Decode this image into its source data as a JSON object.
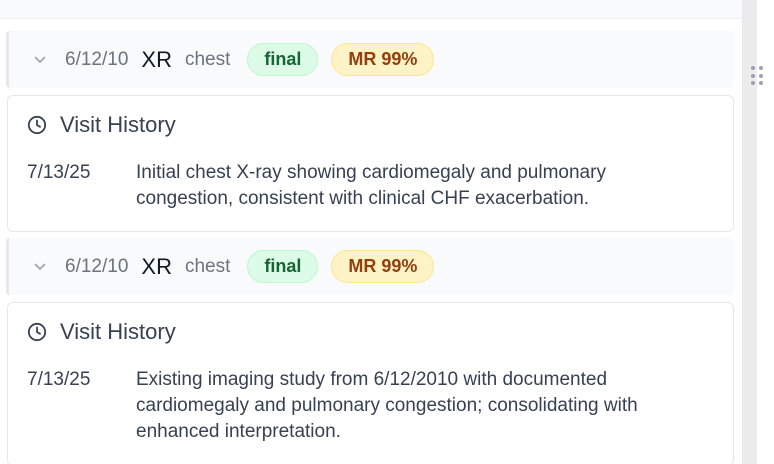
{
  "studies": [
    {
      "date": "6/12/10",
      "modality": "XR",
      "body_part": "chest",
      "status_badge": "final",
      "match_badge": "MR 99%",
      "history": {
        "title": "Visit History",
        "entries": [
          {
            "date": "7/13/25",
            "text": "Initial chest X-ray showing cardiomegaly and pulmonary congestion, consistent with clinical CHF exacerbation."
          }
        ]
      }
    },
    {
      "date": "6/12/10",
      "modality": "XR",
      "body_part": "chest",
      "status_badge": "final",
      "match_badge": "MR 99%",
      "history": {
        "title": "Visit History",
        "entries": [
          {
            "date": "7/13/25",
            "text": "Existing imaging study from 6/12/2010 with documented cardiomegaly and pulmonary congestion; consolidating with enhanced interpretation."
          }
        ]
      }
    }
  ],
  "icons": {
    "expand": "chevron-down-icon",
    "history": "clock-icon",
    "scroll_handle": "drag-handle-icon"
  },
  "colors": {
    "final_badge_bg": "#dcfce7",
    "final_badge_text": "#166534",
    "match_badge_bg": "#fef3c7",
    "match_badge_text": "#92400e"
  }
}
